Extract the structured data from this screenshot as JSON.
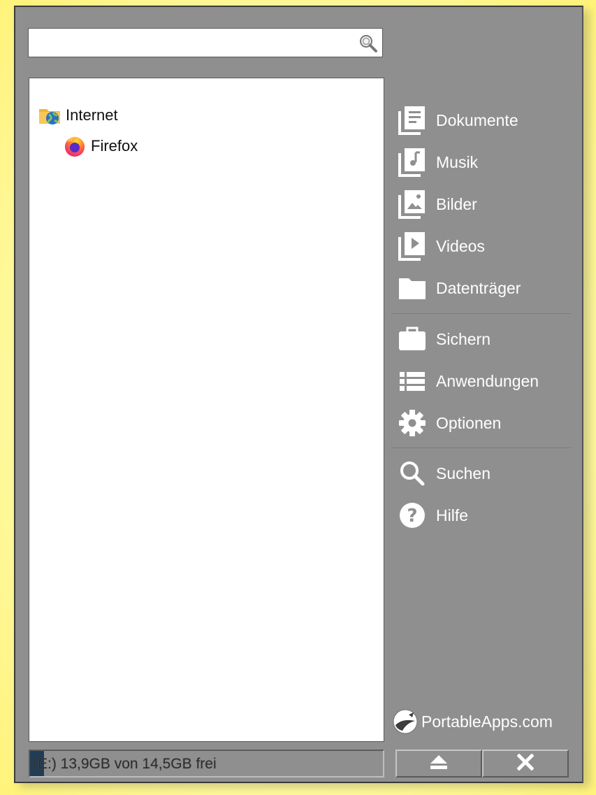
{
  "search": {
    "value": "",
    "placeholder": ""
  },
  "tree": [
    {
      "label": "Internet",
      "icon": "internet-folder-icon"
    },
    {
      "label": "Firefox",
      "icon": "firefox-icon"
    }
  ],
  "sidebar": {
    "items": [
      {
        "label": "Dokumente",
        "icon": "documents-icon"
      },
      {
        "label": "Musik",
        "icon": "music-icon"
      },
      {
        "label": "Bilder",
        "icon": "pictures-icon"
      },
      {
        "label": "Videos",
        "icon": "videos-icon"
      },
      {
        "label": "Datenträger",
        "icon": "folder-icon"
      },
      {
        "label": "Sichern",
        "icon": "briefcase-icon"
      },
      {
        "label": "Anwendungen",
        "icon": "list-icon"
      },
      {
        "label": "Optionen",
        "icon": "gear-icon"
      },
      {
        "label": "Suchen",
        "icon": "search-icon"
      },
      {
        "label": "Hilfe",
        "icon": "help-icon"
      }
    ]
  },
  "brand": {
    "name": "PortableApps.com"
  },
  "drive": {
    "text": "(E:) 13,9GB von 14,5GB frei",
    "used_fraction": 0.04
  },
  "buttons": {
    "eject": "eject-icon",
    "close": "close-icon"
  },
  "colors": {
    "window_bg": "#8f8f8f",
    "page_bg": "#fffba8",
    "drive_fill": "#203d55",
    "text_light": "#ffffff"
  }
}
